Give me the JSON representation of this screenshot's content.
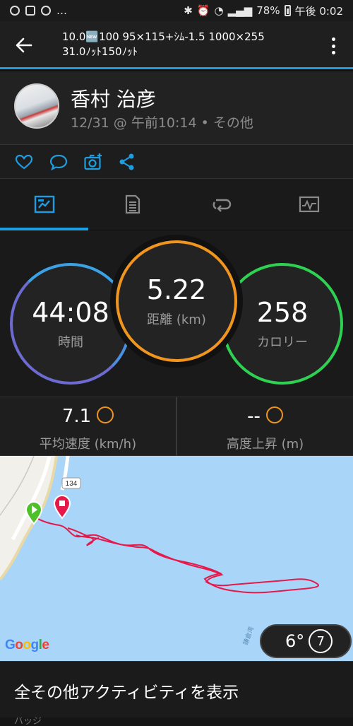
{
  "statusbar": {
    "battery": "78%",
    "time": "午後 0:02"
  },
  "header": {
    "title_line1": "10.0🆕100 95×115+ｼﾑ-1.5 1000×255",
    "title_line2": "31.0ﾉｯﾄ150ﾉｯﾄ"
  },
  "profile": {
    "name": "香村 治彦",
    "meta": "12/31 @ 午前10:14 • その他"
  },
  "stats": {
    "time_value": "44:08",
    "time_label": "時間",
    "distance_value": "5.22",
    "distance_label": "距離 (km)",
    "calories_value": "258",
    "calories_label": "カロリー"
  },
  "metrics": {
    "avg_speed_value": "7.1",
    "avg_speed_label": "平均速度 (km/h)",
    "elev_gain_value": "--",
    "elev_gain_label": "高度上昇 (m)"
  },
  "map": {
    "road_number": "134",
    "attribution": "Google",
    "water_label": "鎌倉湾",
    "temperature": "6°",
    "wind_speed": "7"
  },
  "more": {
    "label": "全その他アクティビティを表示"
  },
  "peek": {
    "text": "バッジ"
  },
  "colors": {
    "accent": "#1e9de0",
    "distance_ring": "#f0951e",
    "calories_ring": "#2ed151",
    "time_ring": "#6d6ad0",
    "track": "#e5194a"
  }
}
